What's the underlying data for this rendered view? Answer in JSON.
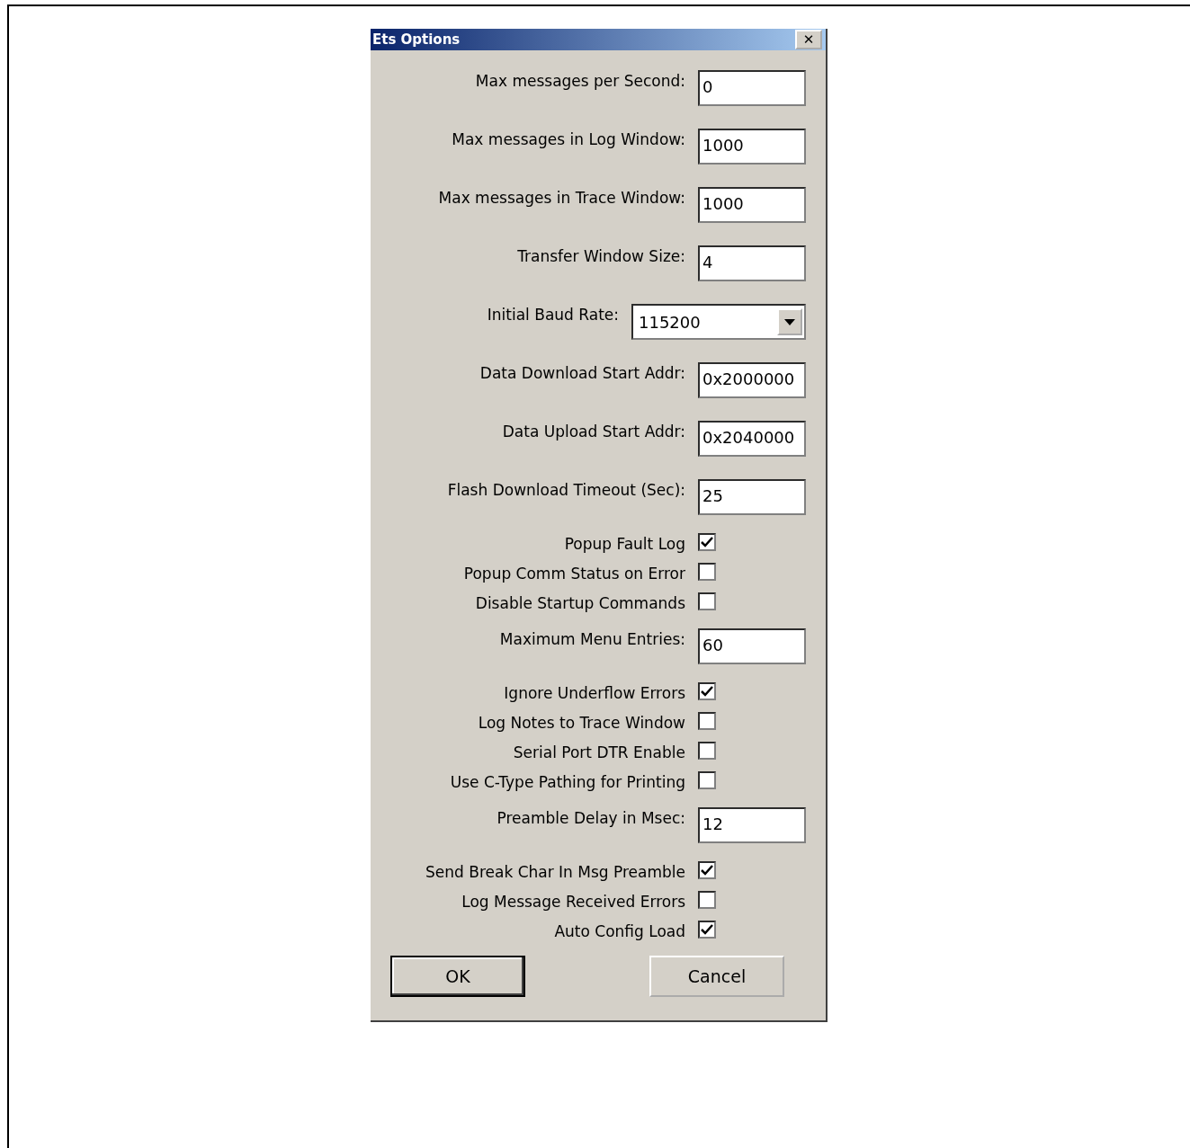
{
  "window": {
    "title": "Ets Options",
    "close": "✕"
  },
  "options": [
    {
      "kind": "text",
      "label": "Max messages per Second:",
      "value": "0"
    },
    {
      "kind": "text",
      "label": "Max messages in Log Window:",
      "value": "1000"
    },
    {
      "kind": "text",
      "label": "Max messages in Trace Window:",
      "value": "1000"
    },
    {
      "kind": "text",
      "label": "Transfer Window Size:",
      "value": "4"
    },
    {
      "kind": "select",
      "label": "Initial Baud Rate:",
      "value": "115200"
    },
    {
      "kind": "text",
      "label": "Data Download Start Addr:",
      "value": "0x2000000"
    },
    {
      "kind": "text",
      "label": "Data Upload Start Addr:",
      "value": "0x2040000"
    },
    {
      "kind": "text",
      "label": "Flash Download Timeout (Sec):",
      "value": "25"
    },
    {
      "kind": "checkbox",
      "label": "Popup Fault Log",
      "checked": true
    },
    {
      "kind": "checkbox",
      "label": "Popup Comm Status on Error",
      "checked": false
    },
    {
      "kind": "checkbox",
      "label": "Disable Startup Commands",
      "checked": false
    },
    {
      "kind": "text",
      "label": "Maximum Menu Entries:",
      "value": "60"
    },
    {
      "kind": "checkbox",
      "label": "Ignore Underflow Errors",
      "checked": true
    },
    {
      "kind": "checkbox",
      "label": "Log Notes to Trace Window",
      "checked": false
    },
    {
      "kind": "checkbox",
      "label": "Serial Port DTR Enable",
      "checked": false
    },
    {
      "kind": "checkbox",
      "label": "Use C-Type Pathing for Printing",
      "checked": false
    },
    {
      "kind": "text",
      "label": "Preamble Delay in Msec:",
      "value": "12"
    },
    {
      "kind": "checkbox",
      "label": "Send Break Char In Msg Preamble",
      "checked": true
    },
    {
      "kind": "checkbox",
      "label": "Log Message Received Errors",
      "checked": false
    },
    {
      "kind": "checkbox",
      "label": "Auto Config Load",
      "checked": true
    }
  ],
  "buttons": [
    {
      "label": "OK",
      "default": true
    },
    {
      "label": "Cancel",
      "default": false
    }
  ]
}
